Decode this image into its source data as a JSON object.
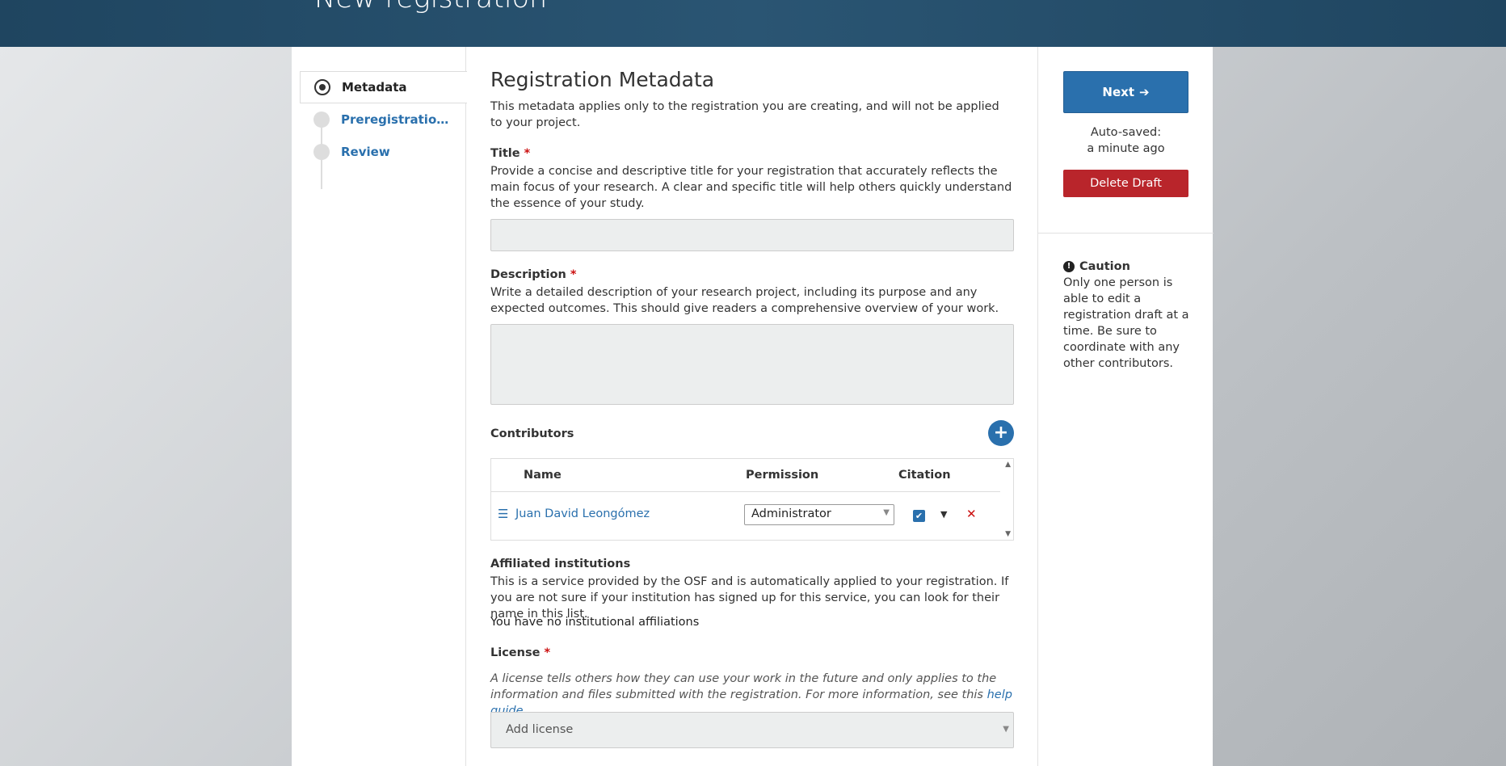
{
  "header": {
    "title": "New registration"
  },
  "nav": {
    "items": [
      {
        "label": "Metadata"
      },
      {
        "label": "Preregistration Te..."
      },
      {
        "label": "Review"
      }
    ]
  },
  "main": {
    "title": "Registration Metadata",
    "intro": "This metadata applies only to the registration you are creating, and will not be applied to your project.",
    "title_field": {
      "label": "Title",
      "required": "*",
      "help": "Provide a concise and descriptive title for your registration that accurately reflects the main focus of your research. A clear and specific title will help others quickly understand the essence of your study.",
      "value": ""
    },
    "description_field": {
      "label": "Description",
      "required": "*",
      "help": "Write a detailed description of your research project, including its purpose and any expected outcomes. This should give readers a comprehensive overview of your work.",
      "value": ""
    },
    "contributors": {
      "label": "Contributors",
      "add_icon": "plus-icon",
      "columns": [
        "Name",
        "Permission",
        "Citation"
      ],
      "rows": [
        {
          "name": "Juan David Leongómez",
          "permission": "Administrator",
          "citation": true
        }
      ]
    },
    "affiliations": {
      "label": "Affiliated institutions",
      "help": "This is a service provided by the OSF and is automatically applied to your registration. If you are not sure if your institution has signed up for this service, you can look for their name in this list.",
      "empty": "You have no institutional affiliations"
    },
    "license": {
      "label": "License",
      "required": "*",
      "help": "A license tells others how they can use your work in the future and only applies to the information and files submitted with the registration. For more information, see this ",
      "help_link": "help guide",
      "help_end": ".",
      "placeholder": "Add license"
    }
  },
  "sidebar": {
    "next_label": "Next",
    "autosave_line1": "Auto-saved:",
    "autosave_line2": "a minute ago",
    "delete_label": "Delete Draft",
    "caution_title": "Caution",
    "caution_text": "Only one person is able to edit a registration draft at a time. Be sure to coordinate with any other contributors."
  },
  "colors": {
    "primary": "#2a70ad",
    "danger": "#b9252b",
    "header": "#214762"
  }
}
